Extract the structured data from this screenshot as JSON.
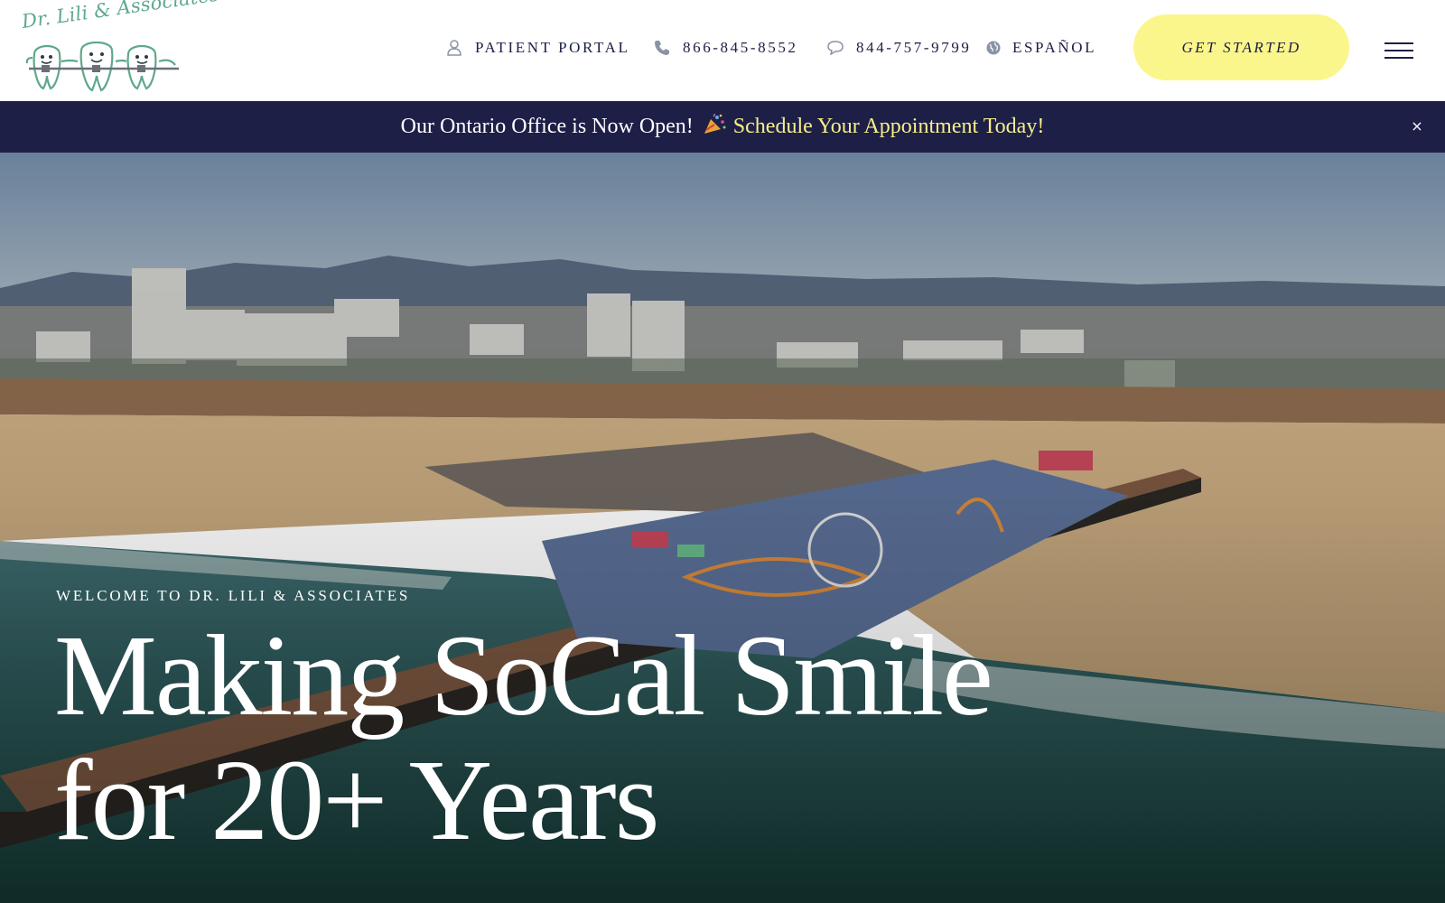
{
  "logo": {
    "script_text": "Dr. Lili & Associates",
    "icon": "smiling-teeth-with-braces-logo"
  },
  "nav": {
    "patient_portal": {
      "label": "PATIENT PORTAL",
      "icon": "user-icon"
    },
    "phone": {
      "label": "866-845-8552",
      "icon": "phone-icon"
    },
    "text": {
      "label": "844-757-9799",
      "icon": "chat-bubble-icon"
    },
    "language": {
      "label": "ESPAÑOL",
      "icon": "globe-icon"
    },
    "cta_label": "GET STARTED",
    "menu_icon": "hamburger-menu-icon"
  },
  "banner": {
    "message": "Our Ontario Office is Now Open!",
    "emoji": "party-popper-icon",
    "link": "Schedule Your Appointment Today!",
    "close": "×"
  },
  "hero": {
    "eyebrow": "WELCOME TO DR. LILI & ASSOCIATES",
    "headline_line1": "Making SoCal Smile",
    "headline_line2": "for 20+ Years",
    "background": "aerial photo of Santa Monica pier and beach"
  },
  "colors": {
    "navy": "#1e1f47",
    "cta_yellow": "#fbf68b",
    "banner_link_yellow": "#f6ef8a",
    "logo_green": "#5fa88c",
    "icon_gray": "#8a93a6"
  }
}
